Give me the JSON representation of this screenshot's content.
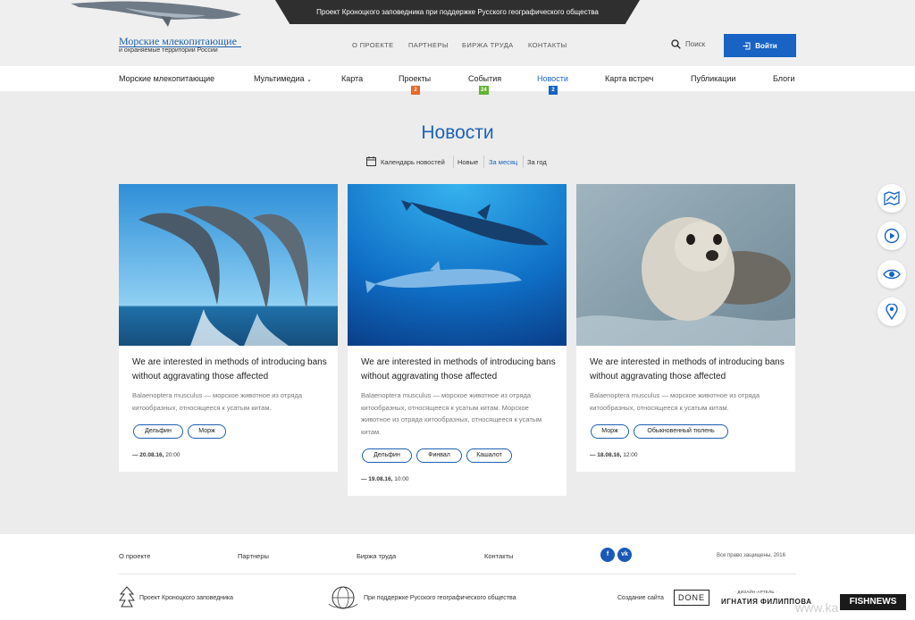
{
  "ribbon": {
    "text": "Проект Кроноцкого заповедника при поддержке Русского географического общества"
  },
  "logo": {
    "title": "Морские млекопитающие",
    "subtitle": "и охраняемые территории России"
  },
  "top_nav": [
    "О ПРОЕКТЕ",
    "ПАРТНЕРЫ",
    "БИРЖА ТРУДА",
    "КОНТАКТЫ"
  ],
  "search": {
    "label": "Поиск"
  },
  "login": {
    "label": "Войти"
  },
  "main_nav": {
    "items": [
      "Морские млекопитающие",
      "Мультимедиа",
      "Карта",
      "Проекты",
      "События",
      "Новости",
      "Карта встреч",
      "Публикации",
      "Блоги"
    ],
    "badges": {
      "projects": "2",
      "events": "24",
      "news": "2"
    },
    "active": "Новости"
  },
  "page": {
    "title": "Новости"
  },
  "filters": {
    "calendar": "Календарь новостей",
    "new": "Новые",
    "month": "За месяц",
    "year": "За год"
  },
  "cards": [
    {
      "title": "We are interested in methods of introducing bans without aggravating those affected",
      "text": "Balaenoptera musculus — морское животное из отряда китообразных, относящееся к усатым китам.",
      "tags": [
        "Дельфин",
        "Морж"
      ],
      "date_bold": "— 20.08.16,",
      "time": "20:00"
    },
    {
      "title": "We are interested in methods of introducing bans without aggravating those affected",
      "text": "Balaenoptera musculus — морское животное из отряда китообразных, относящееся к усатым китам. Морское животное из отряда китообразных, относящееся к усатым китам.",
      "tags": [
        "Дельфин",
        "Финвал",
        "Кашалот"
      ],
      "date_bold": "— 19.08.16,",
      "time": "10:00"
    },
    {
      "title": "We are interested in methods of introducing bans without aggravating those affected",
      "text": "Balaenoptera musculus — морское животное из отряда китообразных, относящееся к усатым китам.",
      "tags": [
        "Морж",
        "Обыкновенный тюлень"
      ],
      "date_bold": "— 18.08.16,",
      "time": "12:00"
    }
  ],
  "side_icons": [
    "map-icon",
    "play-icon",
    "eye-icon",
    "location-pin-icon"
  ],
  "footer": {
    "links": [
      "О проекте",
      "Партнеры",
      "Биржа труда",
      "Контакты"
    ],
    "social": [
      "f",
      "vk"
    ],
    "copyright": "Все право защищены, 2016",
    "partner1": "Проект Кроноцкого заповедника",
    "partner2": "При поддержке Русского географического общества",
    "made_by": "Создание сайта",
    "done": "DONE",
    "design_small": "· ДИЗАЙН-АРТЕЛЬ ·",
    "design_name": "ИГНАТИЯ ФИЛИППОВА",
    "fishnews": "FISHNEWS",
    "watermark": "www.ka"
  },
  "colors": {
    "accent": "#1863c4",
    "orange": "#e8682a",
    "green": "#5fb52f",
    "dark": "#2f2f2f"
  }
}
